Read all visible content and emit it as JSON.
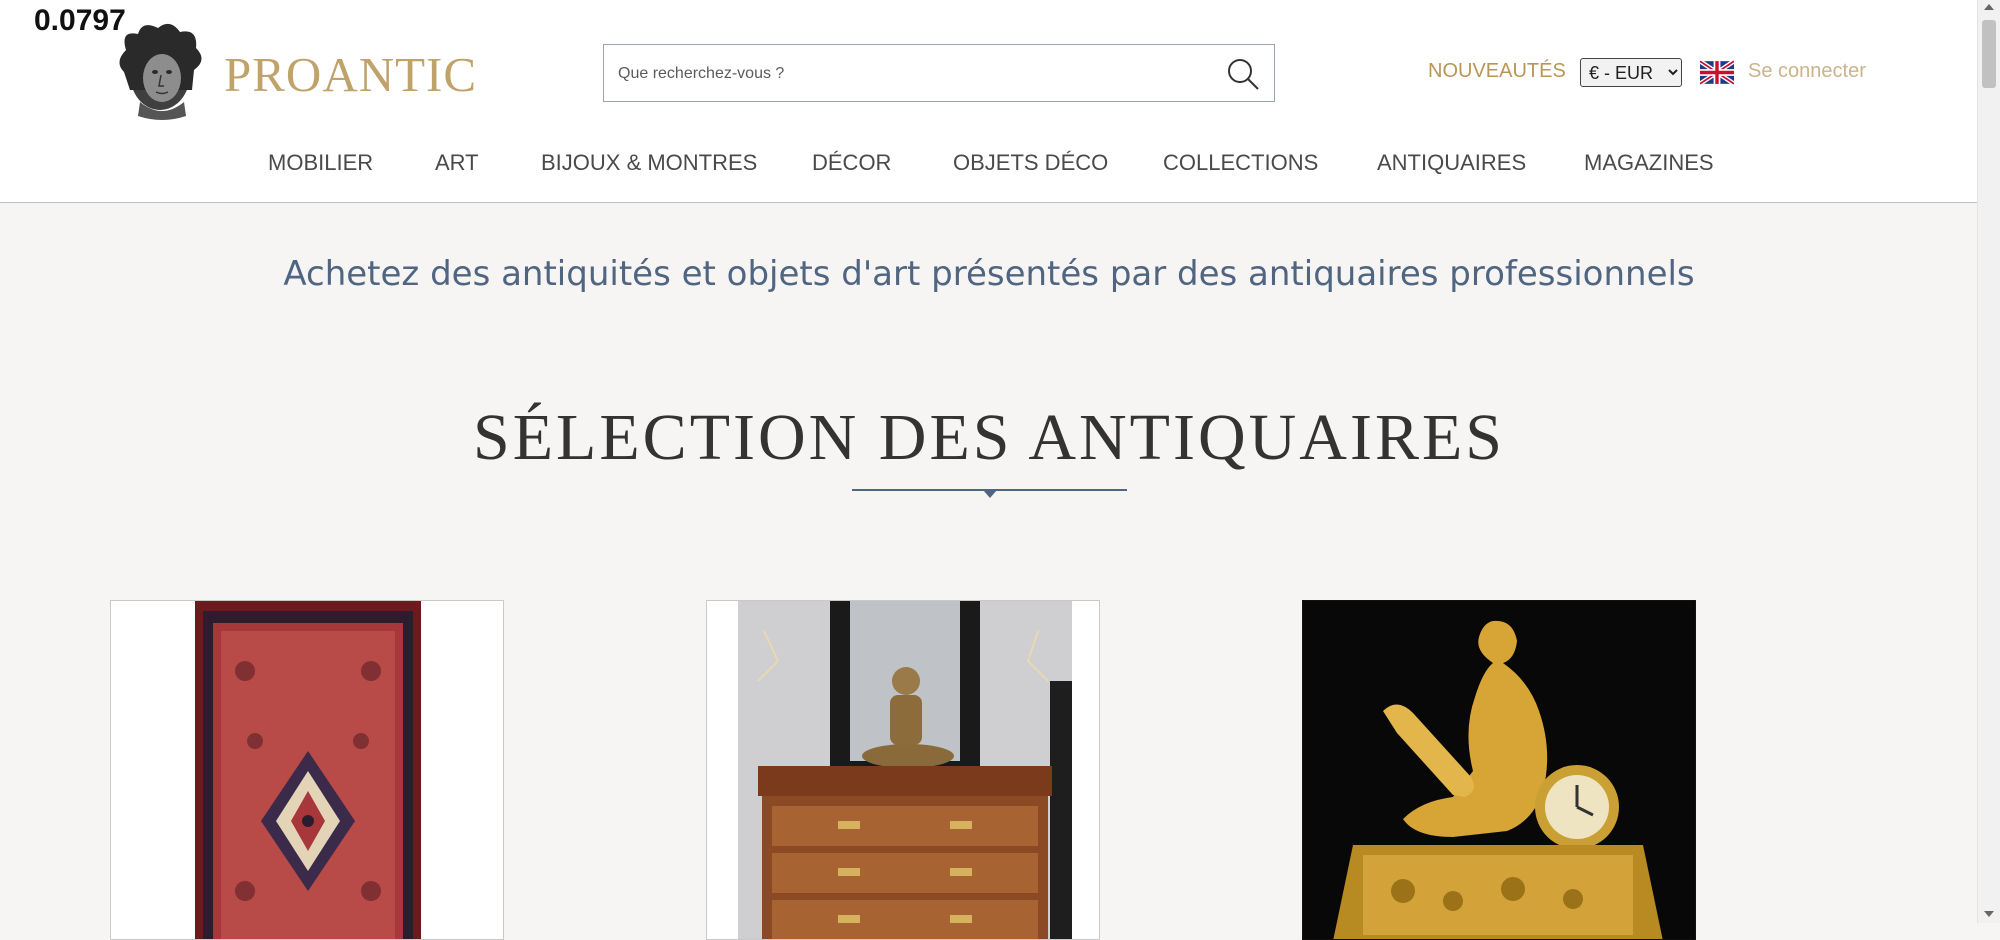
{
  "overlay": {
    "number": "0.0797"
  },
  "brand": {
    "name": "PROANTIC",
    "logo_icon": "medusa-head-logo"
  },
  "search": {
    "placeholder": "Que recherchez-vous ?",
    "icon": "search-icon"
  },
  "topnav": {
    "new_label": "NOUVEAUTÉS",
    "currency_selected": "€ - EUR",
    "language_flag": "uk-flag-icon",
    "login_label": "Se connecter"
  },
  "menu": {
    "items": [
      {
        "label": "MOBILIER"
      },
      {
        "label": "ART"
      },
      {
        "label": "BIJOUX & MONTRES"
      },
      {
        "label": "DÉCOR"
      },
      {
        "label": "OBJETS DÉCO"
      },
      {
        "label": "COLLECTIONS"
      },
      {
        "label": "ANTIQUAIRES"
      },
      {
        "label": "MAGAZINES"
      }
    ]
  },
  "hero": {
    "tagline": "Achetez des antiquités et objets d'art présentés par des antiquaires professionnels"
  },
  "selection": {
    "title": "SÉLECTION DES ANTIQUAIRES",
    "cards": [
      {
        "image": "persian-rug-image"
      },
      {
        "image": "antique-commode-image"
      },
      {
        "image": "gilt-bronze-clock-image"
      }
    ]
  },
  "colors": {
    "brand_gold": "#c0a26b",
    "nav_new_gold": "#b99658",
    "tagline_blue": "#4f6581",
    "page_background": "#f6f5f3"
  }
}
